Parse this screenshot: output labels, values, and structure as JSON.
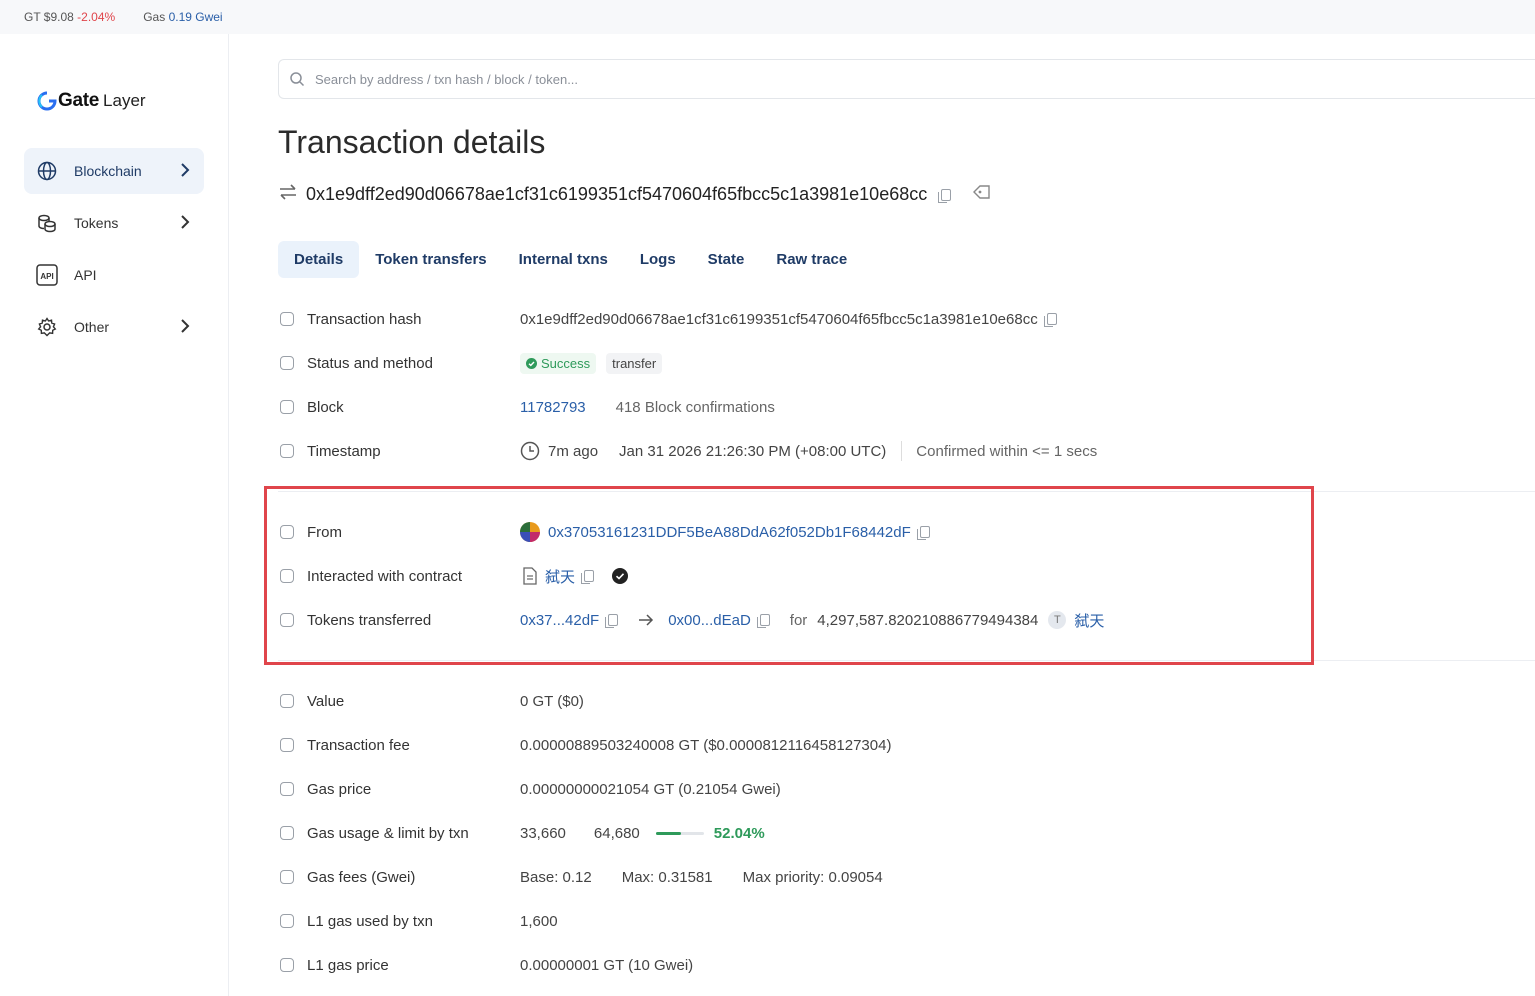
{
  "topbar": {
    "gt_label": "GT",
    "gt_price": "$9.08",
    "gt_change": "-2.04%",
    "gas_label": "Gas",
    "gas_value": "0.19 Gwei"
  },
  "logo": {
    "brand": "Gate",
    "suffix": "Layer"
  },
  "sidebar": {
    "items": [
      {
        "label": "Blockchain",
        "icon": "globe-icon",
        "active": true,
        "chevron": true
      },
      {
        "label": "Tokens",
        "icon": "coins-icon",
        "chevron": true
      },
      {
        "label": "API",
        "icon": "api-icon",
        "chevron": false
      },
      {
        "label": "Other",
        "icon": "gear-icon",
        "chevron": true
      }
    ]
  },
  "search": {
    "placeholder": "Search by address / txn hash / block / token..."
  },
  "page": {
    "title": "Transaction details",
    "hash": "0x1e9dff2ed90d06678ae1cf31c6199351cf5470604f65fbcc5c1a3981e10e68cc"
  },
  "tabs": [
    "Details",
    "Token transfers",
    "Internal txns",
    "Logs",
    "State",
    "Raw trace"
  ],
  "details": {
    "tx_hash_label": "Transaction hash",
    "tx_hash_value": "0x1e9dff2ed90d06678ae1cf31c6199351cf5470604f65fbcc5c1a3981e10e68cc",
    "status_label": "Status and method",
    "status_value": "Success",
    "method_value": "transfer",
    "block_label": "Block",
    "block_value": "11782793",
    "block_confirmations": "418 Block confirmations",
    "timestamp_label": "Timestamp",
    "timestamp_ago": "7m ago",
    "timestamp_full": "Jan 31 2026 21:26:30 PM (+08:00 UTC)",
    "timestamp_confirmed": "Confirmed within <= 1 secs",
    "from_label": "From",
    "from_value": "0x37053161231DDF5BeA88DdA62f052Db1F68442dF",
    "contract_label": "Interacted with contract",
    "contract_value": "弑天",
    "tokens_label": "Tokens transferred",
    "tokens_from": "0x37...42dF",
    "tokens_to": "0x00...dEaD",
    "tokens_for": "for",
    "tokens_amount": "4,297,587.820210886779494384",
    "token_symbol_icon": "T",
    "token_name": "弑天",
    "value_label": "Value",
    "value_value": "0 GT ($0)",
    "fee_label": "Transaction fee",
    "fee_value": "0.00000889503240008 GT ($0.0000812116458127304)",
    "gas_price_label": "Gas price",
    "gas_price_value": "0.00000000021054 GT (0.21054 Gwei)",
    "gas_usage_label": "Gas usage & limit by txn",
    "gas_used": "33,660",
    "gas_limit": "64,680",
    "gas_pct": "52.04%",
    "gas_pct_fraction": 0.5204,
    "gas_fees_label": "Gas fees (Gwei)",
    "gas_base": "Base: 0.12",
    "gas_max": "Max: 0.31581",
    "gas_priority": "Max priority: 0.09054",
    "l1_used_label": "L1 gas used by txn",
    "l1_used_value": "1,600",
    "l1_price_label": "L1 gas price",
    "l1_price_value": "0.00000001 GT (10 Gwei)"
  },
  "colors": {
    "accent": "#2a5fa8",
    "success": "#2e9a5a",
    "negative": "#e0454b",
    "highlight": "#e0454b"
  }
}
